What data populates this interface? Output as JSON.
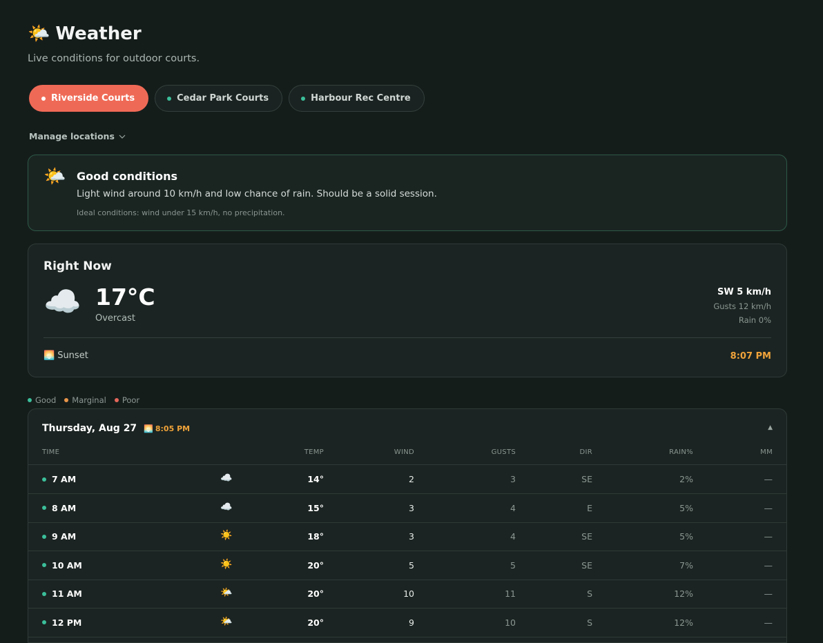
{
  "header": {
    "icon": "sun-behind-cloud-icon",
    "title": "Weather",
    "subtitle": "Live conditions for outdoor courts."
  },
  "locations": [
    {
      "label": "Riverside Courts",
      "active": true
    },
    {
      "label": "Cedar Park Courts",
      "active": false
    },
    {
      "label": "Harbour Rec Centre",
      "active": false
    }
  ],
  "manage_label": "Manage locations",
  "banner": {
    "icon": "sun-behind-cloud-icon",
    "title": "Good conditions",
    "text": "Light wind around 10 km/h and low chance of rain. Should be a solid session.",
    "note": "Ideal conditions: wind under 15 km/h, no precipitation."
  },
  "now": {
    "title": "Right Now",
    "icon": "cloud-icon",
    "temp": "17°C",
    "condition": "Overcast",
    "wind": "SW 5 km/h",
    "gusts": "Gusts 12 km/h",
    "rain": "Rain 0%",
    "sunset_label": "Sunset",
    "sunset_time": "8:07 PM"
  },
  "legend": [
    {
      "label": "Good",
      "color": "#3bbf9a"
    },
    {
      "label": "Marginal",
      "color": "#e8954a"
    },
    {
      "label": "Poor",
      "color": "#e5675a"
    }
  ],
  "forecast": {
    "day": "Thursday, Aug 27",
    "sunset": "8:05 PM",
    "columns": {
      "time": "TIME",
      "temp": "TEMP",
      "wind": "WIND",
      "gusts": "GUSTS",
      "dir": "DIR",
      "rain": "RAIN%",
      "mm": "MM"
    },
    "rows": [
      {
        "time": "7 AM",
        "icon": "cloud-icon",
        "temp": "14°",
        "wind": "2",
        "gusts": "3",
        "dir": "SE",
        "rain": "2%",
        "mm": "—"
      },
      {
        "time": "8 AM",
        "icon": "cloud-icon",
        "temp": "15°",
        "wind": "3",
        "gusts": "4",
        "dir": "E",
        "rain": "5%",
        "mm": "—"
      },
      {
        "time": "9 AM",
        "icon": "sun-icon",
        "temp": "18°",
        "wind": "3",
        "gusts": "4",
        "dir": "SE",
        "rain": "5%",
        "mm": "—"
      },
      {
        "time": "10 AM",
        "icon": "sun-icon",
        "temp": "20°",
        "wind": "5",
        "gusts": "5",
        "dir": "SE",
        "rain": "7%",
        "mm": "—"
      },
      {
        "time": "11 AM",
        "icon": "sun-behind-cloud-icon",
        "temp": "20°",
        "wind": "10",
        "gusts": "11",
        "dir": "S",
        "rain": "12%",
        "mm": "—"
      },
      {
        "time": "12 PM",
        "icon": "sun-behind-cloud-icon",
        "temp": "20°",
        "wind": "9",
        "gusts": "10",
        "dir": "S",
        "rain": "12%",
        "mm": "—"
      }
    ]
  }
}
